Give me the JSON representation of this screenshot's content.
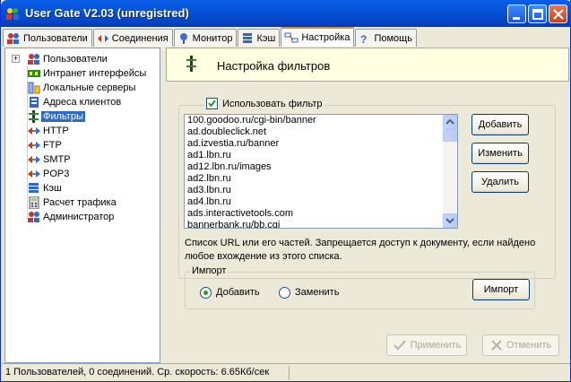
{
  "window": {
    "title": "User Gate V2.03 (unregistred)",
    "buttons": [
      "minimize",
      "maximize",
      "close"
    ]
  },
  "tabs": [
    {
      "label": "Пользователи",
      "icon": "users-icon"
    },
    {
      "label": "Соединения",
      "icon": "connections-icon"
    },
    {
      "label": "Монитор",
      "icon": "monitor-icon"
    },
    {
      "label": "Кэш",
      "icon": "cache-icon"
    },
    {
      "label": "Настройка",
      "icon": "settings-icon",
      "active": true
    },
    {
      "label": "Помощь",
      "icon": "help-icon"
    }
  ],
  "tree": {
    "items": [
      {
        "label": "Пользователи",
        "icon": "users-icon",
        "expander": "+"
      },
      {
        "label": "Интранет интерфейсы",
        "icon": "network-card-icon"
      },
      {
        "label": "Локальные серверы",
        "icon": "server-icon"
      },
      {
        "label": "Адреса клиентов",
        "icon": "address-book-icon"
      },
      {
        "label": "Фильтры",
        "icon": "filter-icon",
        "selected": true
      },
      {
        "label": "HTTP",
        "icon": "arrows-icon"
      },
      {
        "label": "FTP",
        "icon": "arrows-icon"
      },
      {
        "label": "SMTP",
        "icon": "arrows-icon"
      },
      {
        "label": "POP3",
        "icon": "arrows-icon"
      },
      {
        "label": "Кэш",
        "icon": "cache-icon"
      },
      {
        "label": "Расчет трафика",
        "icon": "calculator-icon"
      },
      {
        "label": "Администратор",
        "icon": "admin-icon"
      }
    ]
  },
  "panel": {
    "header": "Настройка фильтров",
    "use_filter_label": "Использовать фильтр",
    "use_filter_checked": true,
    "filter_list": [
      "100.goodoo.ru/cgi-bin/banner",
      "ad.doubleclick.net",
      "ad.izvestia.ru/banner",
      "ad1.lbn.ru",
      "ad12.lbn.ru/images",
      "ad2.lbn.ru",
      "ad3.lbn.ru",
      "ad4.lbn.ru",
      "ads.interactivetools.com",
      "bannerbank.ru/bb.cgi"
    ],
    "buttons": {
      "add": "Добавить",
      "edit": "Изменить",
      "delete": "Удалить"
    },
    "description": "Список URL или его частей. Запрещается доступ к документу, если найдено любое вхождение из этого списка.",
    "import": {
      "legend": "Импорт",
      "options": [
        "Добавить",
        "Заменить"
      ],
      "selected": "Добавить",
      "button": "Импорт"
    }
  },
  "footer": {
    "apply": "Применить",
    "cancel": "Отменить"
  },
  "status": "1 Пользователей, 0 соединений. Ср. скорость: 6.65Кб/сек",
  "colors": {
    "titlebar": "#0553d7",
    "selection": "#316ac5",
    "header_bg": "#ffffe1",
    "window_bg": "#ece9d8"
  }
}
